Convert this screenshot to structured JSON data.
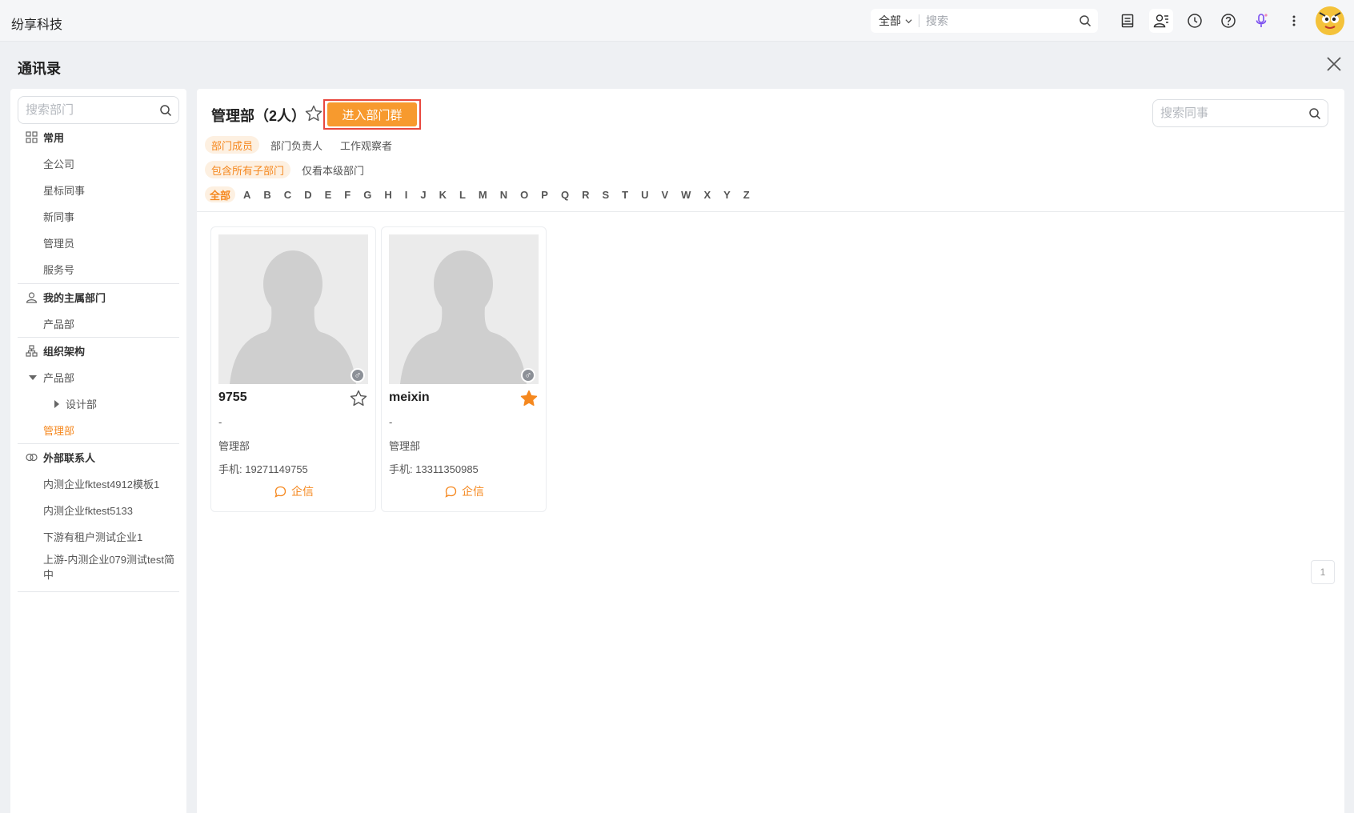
{
  "app": {
    "brand": "纷享科技"
  },
  "global_search": {
    "scope": "全部",
    "placeholder": "搜索"
  },
  "dialog": {
    "title": "通讯录"
  },
  "sidebar": {
    "search_placeholder": "搜索部门",
    "common": {
      "title": "常用",
      "items": [
        "全公司",
        "星标同事",
        "新同事",
        "管理员",
        "服务号"
      ]
    },
    "my_dept": {
      "title": "我的主属部门",
      "items": [
        "产品部"
      ]
    },
    "org": {
      "title": "组织架构",
      "items": [
        "产品部",
        "设计部",
        "管理部"
      ],
      "active": "管理部"
    },
    "external": {
      "title": "外部联系人",
      "items": [
        "内测企业fktest4912模板1",
        "内测企业fktest5133",
        "下游有租户测试企业1",
        "上游-内测企业079测试test简中"
      ]
    }
  },
  "main": {
    "dept_title": "管理部（2人）",
    "enter_group_label": "进入部门群",
    "colleague_search_placeholder": "搜索同事",
    "role_tabs": [
      "部门成员",
      "部门负责人",
      "工作观察者"
    ],
    "scope_tabs": [
      "包含所有子部门",
      "仅看本级部门"
    ],
    "letters": [
      "全部",
      "A",
      "B",
      "C",
      "D",
      "E",
      "F",
      "G",
      "H",
      "I",
      "J",
      "K",
      "L",
      "M",
      "N",
      "O",
      "P",
      "Q",
      "R",
      "S",
      "T",
      "U",
      "V",
      "W",
      "X",
      "Y",
      "Z"
    ],
    "members": [
      {
        "name": "9755",
        "title": "-",
        "dept": "管理部",
        "phone": "手机: 19271149755",
        "starred": false,
        "message_label": "企信",
        "gender": "♂"
      },
      {
        "name": "meixin",
        "title": "-",
        "dept": "管理部",
        "phone": "手机: 13311350985",
        "starred": true,
        "message_label": "企信",
        "gender": "♂"
      }
    ],
    "page": "1"
  },
  "colors": {
    "accent": "#f5881f",
    "button": "#f79a2e",
    "highlight_border": "#e8483f"
  }
}
